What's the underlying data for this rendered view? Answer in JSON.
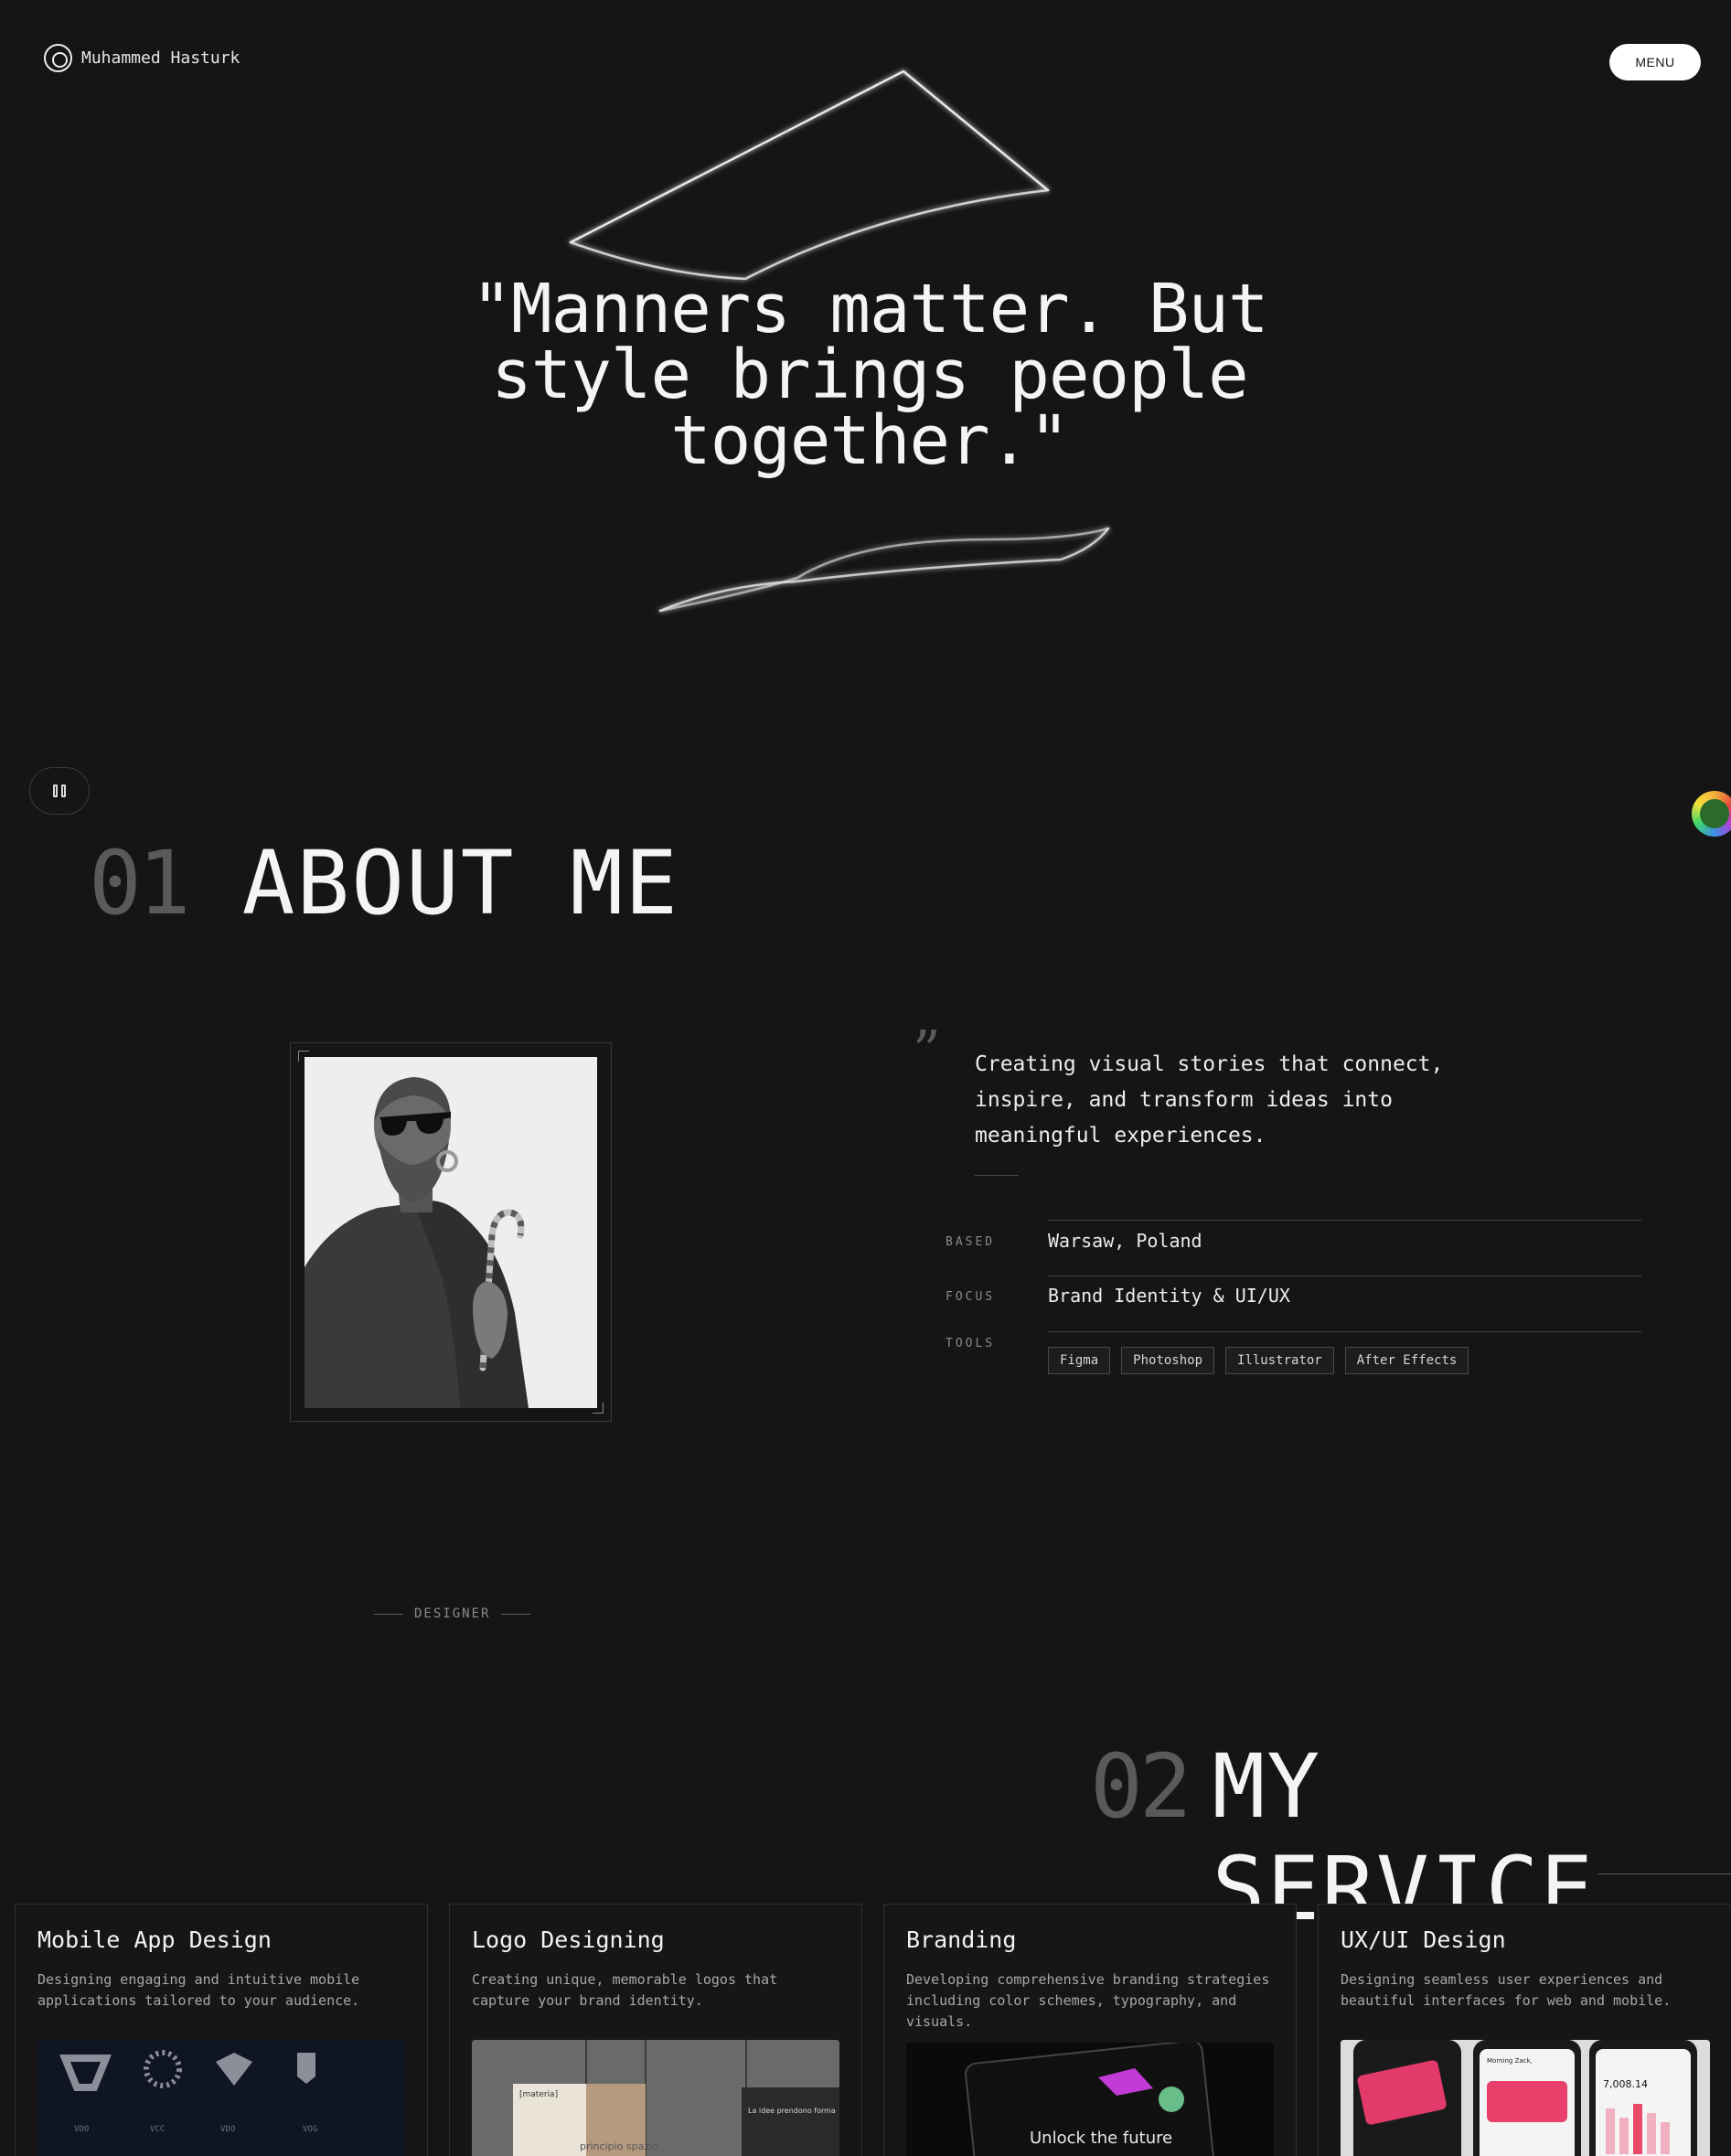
{
  "header": {
    "brand_name": "Muhammed Hasturk",
    "menu_label": "MENU"
  },
  "hero": {
    "quote": "\"Manners matter. But style brings people together.\""
  },
  "about": {
    "number": "01",
    "title": "ABOUT ME",
    "quote_mark": "”",
    "statement": "Creating visual stories that connect, inspire, and transform ideas into meaningful experiences.",
    "info": {
      "based_label": "BASED",
      "based_value": "Warsaw, Poland",
      "focus_label": "FOCUS",
      "focus_value": "Brand Identity & UI/UX",
      "tools_label": "TOOLS",
      "tools": [
        "Figma",
        "Photoshop",
        "Illustrator",
        "After Effects"
      ]
    },
    "designer_label": "DESIGNER"
  },
  "services": {
    "number": "02",
    "title": "MY SERVICE",
    "cards": [
      {
        "title": "Mobile App Design",
        "description": "Designing engaging and intuitive mobile applications tailored to your audience."
      },
      {
        "title": "Logo Designing",
        "description": "Creating unique, memorable logos that capture your brand identity."
      },
      {
        "title": "Branding",
        "description": "Developing comprehensive branding strategies including color schemes, typography, and visuals."
      },
      {
        "title": "UX/UI Design",
        "description": "Designing seamless user experiences and beautiful interfaces for web and mobile."
      }
    ],
    "card_images": {
      "logo_brands": [
        "VDO",
        "VCC",
        "VDO",
        "VOG"
      ],
      "logo_card_panel": "[materia]",
      "logo_card_caption": "principio spazio",
      "logo_card_side": "La idee prendono forma",
      "branding_headline": "Unlock the future",
      "ux_amount": "7,008.14",
      "ux_greeting": "Morning Zack,"
    }
  },
  "colors": {
    "background": "#151515",
    "text": "#eaeaea",
    "muted": "#5a5a5a"
  }
}
